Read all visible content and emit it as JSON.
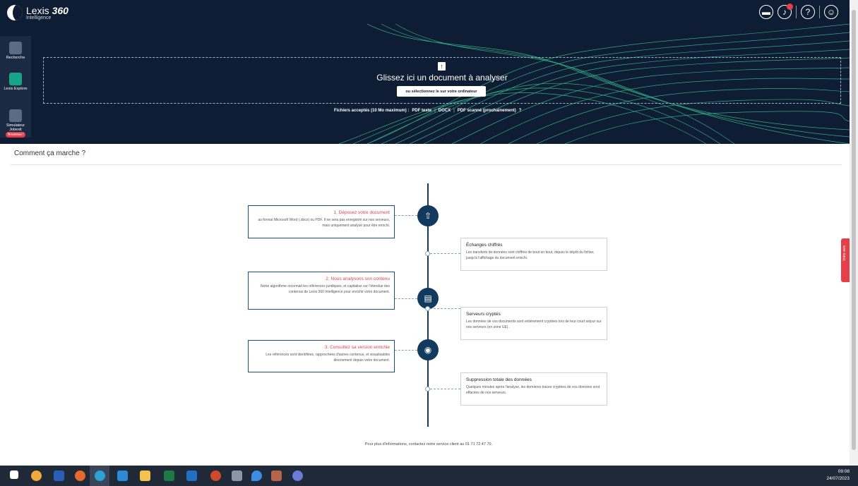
{
  "brand": {
    "name": "Lexis",
    "name_suffix": "360",
    "sub": "Intelligence"
  },
  "topbar_icons": [
    "folder-icon",
    "bell-icon",
    "help-icon",
    "user-icon"
  ],
  "sidebar": {
    "items": [
      {
        "label": "Recherche",
        "icon": "search-icon"
      },
      {
        "label": "Lexis Explore",
        "icon": "explore-icon"
      },
      {
        "label": "Simulateur Jobexit",
        "icon": "calculator-icon",
        "badge": "Nouveau !"
      }
    ]
  },
  "upload": {
    "title": "Glissez ici un document à analyser",
    "button": "ou sélectionnez le sur votre ordinateur",
    "accepted_label": "Fichiers acceptés (10 Mo maximum) :",
    "formats": [
      "PDF texte",
      "DOCX",
      "PDF scanné (prochainement)"
    ],
    "help": "?"
  },
  "how_it_works": {
    "title": "Comment ça marche ?",
    "steps": [
      {
        "title": "1. Déposez votre document",
        "desc": "au format Microsoft Word (.docx) ou PDF. Il ne sera pas enregistré sur nos serveurs, mais uniquement analysé pour être enrichi."
      },
      {
        "title": "2. Nous analysons son contenu",
        "desc": "Notre algorithme reconnait les références juridiques, et capitalise sur l'étendue des contenus de Lexis 360 Intelligence pour enrichir votre document."
      },
      {
        "title": "3. Consultez sa version enrichie",
        "desc": "Les références sont identifiées, rapprochées d'autres contenus, et visualisables directement depuis votre document."
      }
    ],
    "security": [
      {
        "title": "Échanges chiffrés",
        "desc": "Les transferts de données sont chiffrés de bout en bout, depuis le dépôt du fichier, jusqu'à l'affichage du document enrichi."
      },
      {
        "title": "Serveurs cryptés",
        "desc": "Les données de vos documents sont entièrement cryptées lors de leur court séjour sur nos serveurs (en zone UE)."
      },
      {
        "title": "Suppression totale des données",
        "desc": "Quelques minutes après l'analyse, les dernières traces cryptées de vos données sont effacées de nos serveurs."
      }
    ]
  },
  "footer_note": "Pour plus d'informations, contactez notre service client au 01 71 72 47 70.",
  "feedback_tab": "Votre avis",
  "taskbar": {
    "time": "09:08",
    "date": "24/07/2023"
  },
  "colors": {
    "navy": "#0e1d33",
    "accent_red": "#e53f4a",
    "timeline": "#123a5e",
    "wave_green": "#3fd8a0"
  }
}
